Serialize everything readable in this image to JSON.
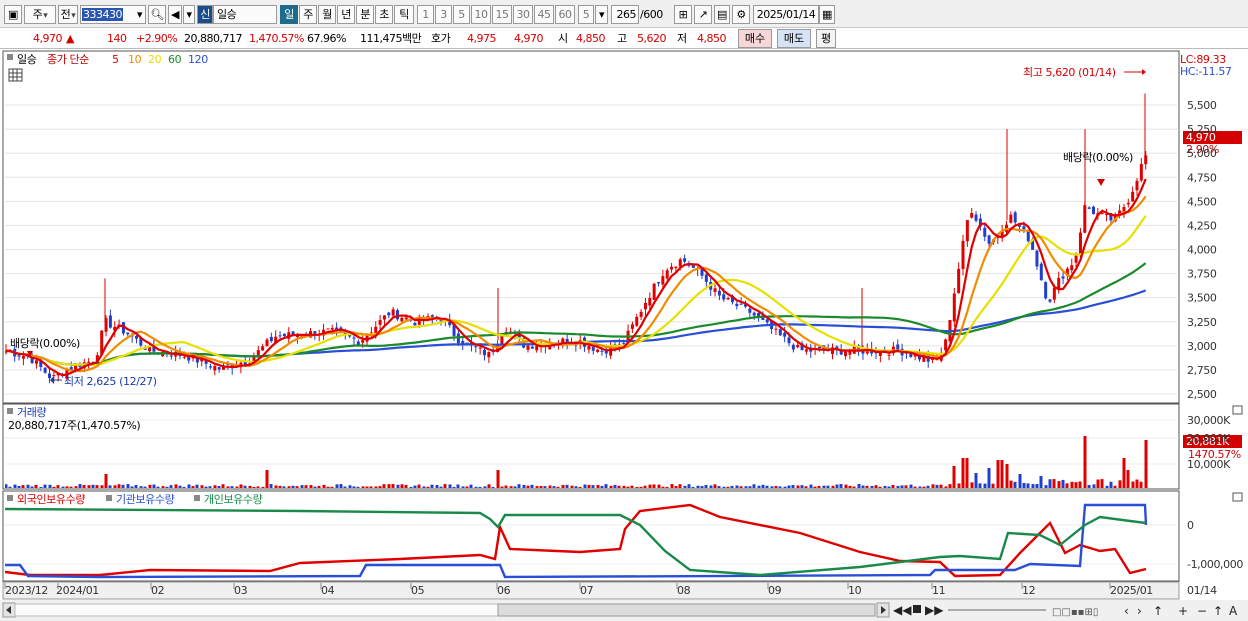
{
  "toolbar": {
    "market": "주",
    "prefix": "전",
    "code": "333430",
    "badge": "신",
    "name": "일승",
    "periods": [
      "일",
      "주",
      "월",
      "년",
      "분",
      "초",
      "틱"
    ],
    "numbers": [
      "1",
      "3",
      "5",
      "10",
      "15",
      "30",
      "45",
      "60"
    ],
    "interval": "5",
    "count": "265",
    "count_total": "/600",
    "date": "2025/01/14"
  },
  "quote": {
    "price": "4,970",
    "arrow": "▲",
    "change": "140",
    "change_pct": "+2.90%",
    "volume": "20,880,717",
    "volume_pct": "1,470.57%",
    "turnover_pct": "67.96%",
    "amount": "111,475백만",
    "bid_label": "호가",
    "bid1": "4,975",
    "bid2": "4,970",
    "open_label": "시",
    "open": "4,850",
    "high_label": "고",
    "high": "5,620",
    "low_label": "저",
    "low": "4,850",
    "buy": "매수",
    "sell": "매도",
    "eval": "평"
  },
  "price_panel": {
    "title": "일승",
    "ma_label": "종가 단순",
    "ma": [
      {
        "period": "5",
        "color": "#e00000"
      },
      {
        "period": "10",
        "color": "#f08c00"
      },
      {
        "period": "20",
        "color": "#e8e000"
      },
      {
        "period": "60",
        "color": "#1a8a2a"
      },
      {
        "period": "120",
        "color": "#2a4fd6"
      }
    ],
    "lc": "LC:89.33",
    "hc": "HC:-11.57",
    "max_note": "최고 5,620 (01/14)",
    "min_note": "최저 2,625 (12/27)",
    "div_left": "배당락(0.00%)",
    "div_right": "배당락(0.00%)",
    "last_price": "4,970",
    "last_pct": "2.90%",
    "yticks": [
      "5,500",
      "5,250",
      "5,000",
      "4,750",
      "4,500",
      "4,250",
      "4,000",
      "3,750",
      "3,500",
      "3,250",
      "3,000",
      "2,750",
      "2,500"
    ]
  },
  "volume_panel": {
    "title": "거래량",
    "value_label": "20,880,717주(1,470.57%)",
    "last": "20,881K",
    "last_pct": "1470.57%",
    "yticks": [
      "30,000K",
      "20,000K",
      "10,000K"
    ]
  },
  "holding_panel": {
    "series": [
      {
        "name": "외국인보유수량",
        "color": "#e00000"
      },
      {
        "name": "기관보유수량",
        "color": "#2a4fd6"
      },
      {
        "name": "개인보유수량",
        "color": "#1a8a4a"
      }
    ],
    "yticks": [
      "0",
      "-1,000,000"
    ]
  },
  "x_axis": {
    "labels": [
      "2023/12",
      "2024/01",
      "02",
      "03",
      "04",
      "05",
      "06",
      "07",
      "08",
      "09",
      "10",
      "11",
      "12",
      "2025/01"
    ],
    "right_label": "01/14"
  }
}
